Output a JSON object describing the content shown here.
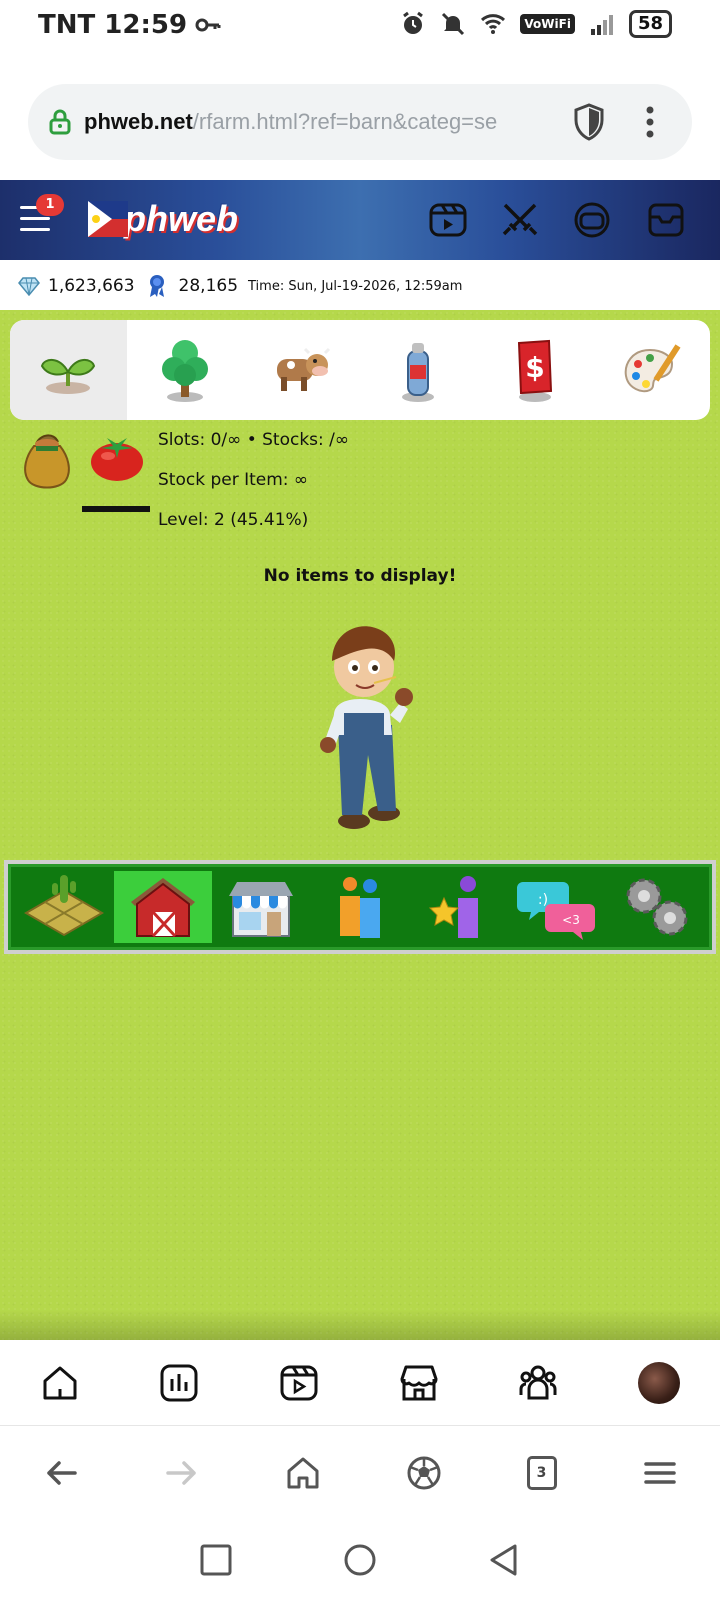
{
  "status_bar": {
    "carrier_time": "TNT 12:59",
    "vowifi": "VoWiFi",
    "battery": "58"
  },
  "url_bar": {
    "domain": "phweb.net",
    "path": "/rfarm.html?ref=barn&categ=se"
  },
  "site_header": {
    "notification_count": "1",
    "logo_text": "phweb",
    "icons": [
      "reels-icon",
      "swords-icon",
      "gamepad-icon",
      "inbox-icon"
    ]
  },
  "currency": {
    "diamonds": "1,623,663",
    "ribbons": "28,165",
    "time": "Time: Sun, Jul-19-2026, 12:59am"
  },
  "category_tabs": [
    {
      "name": "seeds",
      "icon": "sprout-icon",
      "active": true
    },
    {
      "name": "trees",
      "icon": "tree-icon",
      "active": false
    },
    {
      "name": "animals",
      "icon": "cow-icon",
      "active": false
    },
    {
      "name": "products",
      "icon": "bottle-icon",
      "active": false
    },
    {
      "name": "money",
      "icon": "dollar-card-icon",
      "active": false
    },
    {
      "name": "decorations",
      "icon": "palette-icon",
      "active": false
    }
  ],
  "barn_info": {
    "slots": "Slots: 0/∞",
    "stocks": "Stocks: /∞",
    "stock_per_item": "Stock per Item: ∞",
    "level": "Level: 2 (45.41%)"
  },
  "empty_message": "No items to display!",
  "bottom_nav": [
    {
      "name": "farm",
      "icon": "farm-plot-icon",
      "active": false
    },
    {
      "name": "barn",
      "icon": "barn-icon",
      "active": true
    },
    {
      "name": "shop",
      "icon": "shop-icon",
      "active": false
    },
    {
      "name": "neighbors",
      "icon": "people-icon",
      "active": false
    },
    {
      "name": "achievements",
      "icon": "star-person-icon",
      "active": false
    },
    {
      "name": "chat",
      "icon": "chat-bubbles-icon",
      "active": false
    },
    {
      "name": "settings",
      "icon": "gears-icon",
      "active": false
    }
  ],
  "app_nav": [
    "home-icon",
    "stats-icon",
    "reels-icon",
    "store-icon",
    "groups-icon",
    "profile-avatar"
  ],
  "browser_nav": {
    "tabs_count": "3"
  },
  "colors": {
    "grass": "#b5d84b",
    "nav_green": "#0f7a10",
    "nav_active": "#3cce3c",
    "header_blue": "#2a4f9a"
  }
}
